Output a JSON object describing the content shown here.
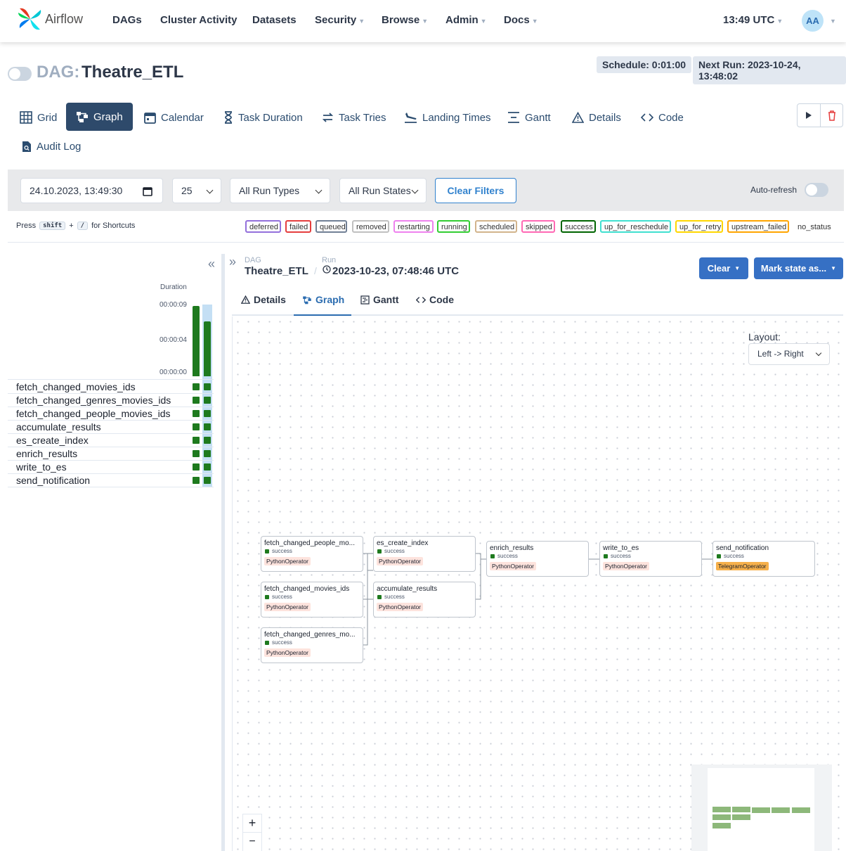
{
  "app": {
    "name": "Airflow"
  },
  "nav": {
    "items": [
      {
        "label": "DAGs",
        "has_menu": false
      },
      {
        "label": "Cluster Activity",
        "has_menu": false
      },
      {
        "label": "Datasets",
        "has_menu": false
      },
      {
        "label": "Security",
        "has_menu": true
      },
      {
        "label": "Browse",
        "has_menu": true
      },
      {
        "label": "Admin",
        "has_menu": true
      },
      {
        "label": "Docs",
        "has_menu": true
      }
    ],
    "time": "13:49 UTC",
    "avatar": "AA"
  },
  "dag": {
    "prefix": "DAG:",
    "name": "Theatre_ETL",
    "schedule": "Schedule: 0:01:00",
    "next_run": "Next Run: 2023-10-24, 13:48:02"
  },
  "tabs": [
    {
      "label": "Grid",
      "icon": "grid-icon"
    },
    {
      "label": "Graph",
      "icon": "graph-icon",
      "active": true
    },
    {
      "label": "Calendar",
      "icon": "calendar-icon"
    },
    {
      "label": "Task Duration",
      "icon": "hourglass-icon"
    },
    {
      "label": "Task Tries",
      "icon": "retry-icon"
    },
    {
      "label": "Landing Times",
      "icon": "plane-landing-icon"
    },
    {
      "label": "Gantt",
      "icon": "gantt-icon"
    },
    {
      "label": "Details",
      "icon": "warning-triangle-icon"
    },
    {
      "label": "Code",
      "icon": "code-icon"
    },
    {
      "label": "Audit Log",
      "icon": "audit-log-icon"
    }
  ],
  "filters": {
    "datetime": "24.10.2023, 13:49:30",
    "num_runs": "25",
    "run_types": "All Run Types",
    "run_states": "All Run States",
    "clear_label": "Clear Filters",
    "auto_refresh": "Auto-refresh"
  },
  "shortcuts": {
    "press": "Press",
    "key1": "shift",
    "plus": "+",
    "key2": "/",
    "suffix": "for Shortcuts"
  },
  "legend": [
    {
      "label": "deferred",
      "color": "#9370db"
    },
    {
      "label": "failed",
      "color": "#e53e3e"
    },
    {
      "label": "queued",
      "color": "#718096"
    },
    {
      "label": "removed",
      "color": "#c0c0c0"
    },
    {
      "label": "restarting",
      "color": "#ee82ee"
    },
    {
      "label": "running",
      "color": "#32cd32"
    },
    {
      "label": "scheduled",
      "color": "#d2b48c"
    },
    {
      "label": "skipped",
      "color": "#ff69b4"
    },
    {
      "label": "success",
      "color": "#006400"
    },
    {
      "label": "up_for_reschedule",
      "color": "#40e0d0"
    },
    {
      "label": "up_for_retry",
      "color": "#ffd700"
    },
    {
      "label": "upstream_failed",
      "color": "#ffa500"
    },
    {
      "label": "no_status",
      "color": ""
    }
  ],
  "grid": {
    "duration_label": "Duration",
    "ticks": [
      "00:00:09",
      "00:00:04",
      "00:00:00"
    ],
    "run_durations": [
      9,
      7
    ],
    "tasks": [
      "fetch_changed_movies_ids",
      "fetch_changed_genres_movies_ids",
      "fetch_changed_people_movies_ids",
      "accumulate_results",
      "es_create_index",
      "enrich_results",
      "write_to_es",
      "send_notification"
    ]
  },
  "run_header": {
    "dag_label": "DAG",
    "dag_name": "Theatre_ETL",
    "run_label": "Run",
    "run_time": "2023-10-23, 07:48:46 UTC",
    "clear_btn": "Clear",
    "mark_btn": "Mark state as..."
  },
  "subtabs": [
    {
      "label": "Details",
      "icon": "warning-triangle-icon"
    },
    {
      "label": "Graph",
      "icon": "graph-icon",
      "active": true
    },
    {
      "label": "Gantt",
      "icon": "gantt-icon"
    },
    {
      "label": "Code",
      "icon": "code-icon"
    }
  ],
  "layout_control": {
    "label": "Layout:",
    "value": "Left -> Right"
  },
  "graph_nodes": [
    {
      "name": "fetch_changed_people_mo...",
      "status": "success",
      "operator": "PythonOperator"
    },
    {
      "name": "fetch_changed_movies_ids",
      "status": "success",
      "operator": "PythonOperator"
    },
    {
      "name": "fetch_changed_genres_mo...",
      "status": "success",
      "operator": "PythonOperator"
    },
    {
      "name": "es_create_index",
      "status": "success",
      "operator": "PythonOperator"
    },
    {
      "name": "accumulate_results",
      "status": "success",
      "operator": "PythonOperator"
    },
    {
      "name": "enrich_results",
      "status": "success",
      "operator": "PythonOperator"
    },
    {
      "name": "write_to_es",
      "status": "success",
      "operator": "PythonOperator"
    },
    {
      "name": "send_notification",
      "status": "success",
      "operator": "TelegramOperator"
    }
  ],
  "zoom": {
    "in": "+",
    "out": "−"
  }
}
